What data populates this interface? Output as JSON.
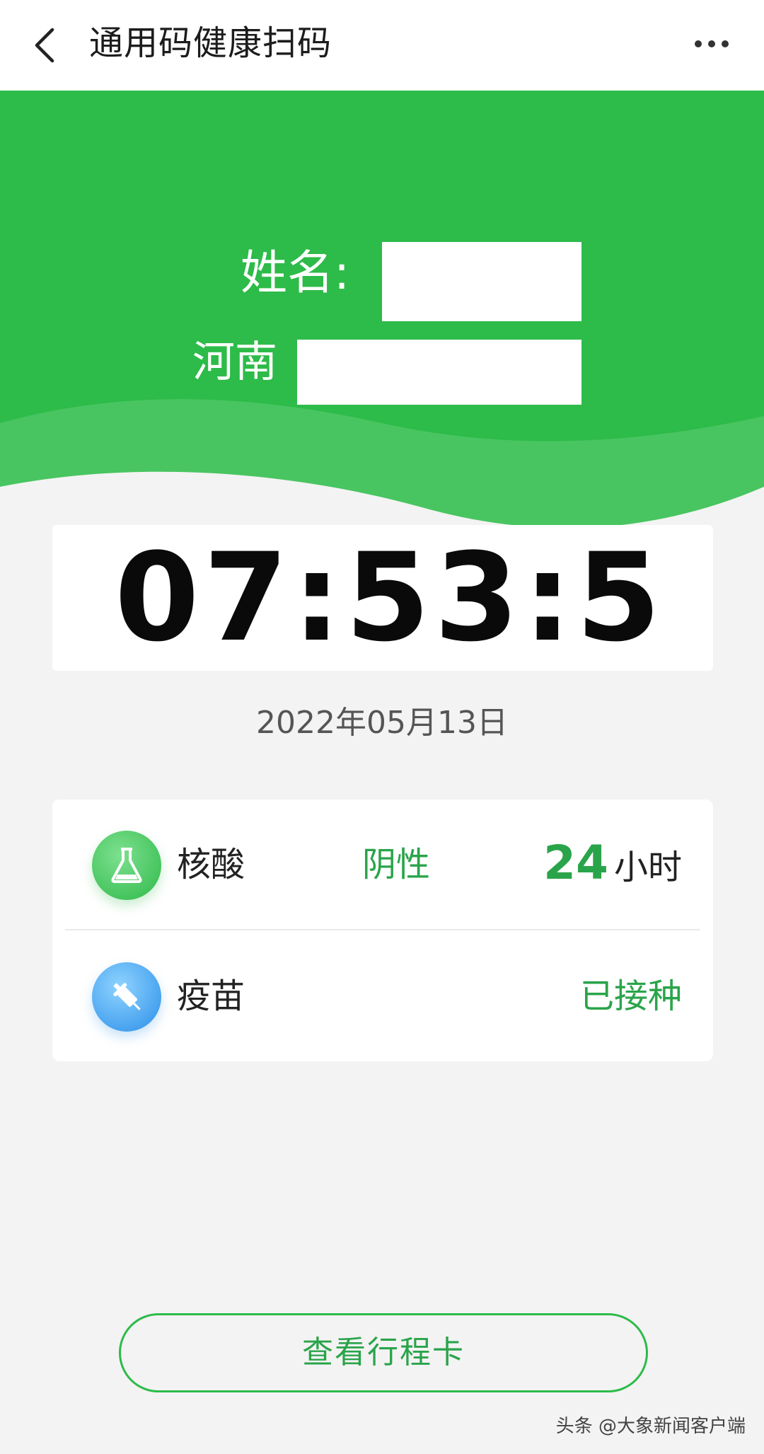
{
  "navbar": {
    "back_icon": "chevron-left-icon",
    "title": "通用码健康扫码",
    "more_icon": "more-dots-icon"
  },
  "header": {
    "background": "#2dbb49",
    "name_label": "姓名:",
    "region_label": "河南"
  },
  "clock": {
    "time": "07:53:5"
  },
  "date": "2022年05月13日",
  "records": [
    {
      "icon": "flask-icon",
      "label": "核酸",
      "status": "阴性",
      "hours_value": "24",
      "hours_unit": "小时"
    },
    {
      "icon": "syringe-icon",
      "label": "疫苗",
      "status": "已接种"
    }
  ],
  "trip_button_label": "查看行程卡",
  "watermark": "头条 @大象新闻客户端",
  "colors": {
    "accent_green": "#2dbb49",
    "status_green": "#2aa44a"
  }
}
